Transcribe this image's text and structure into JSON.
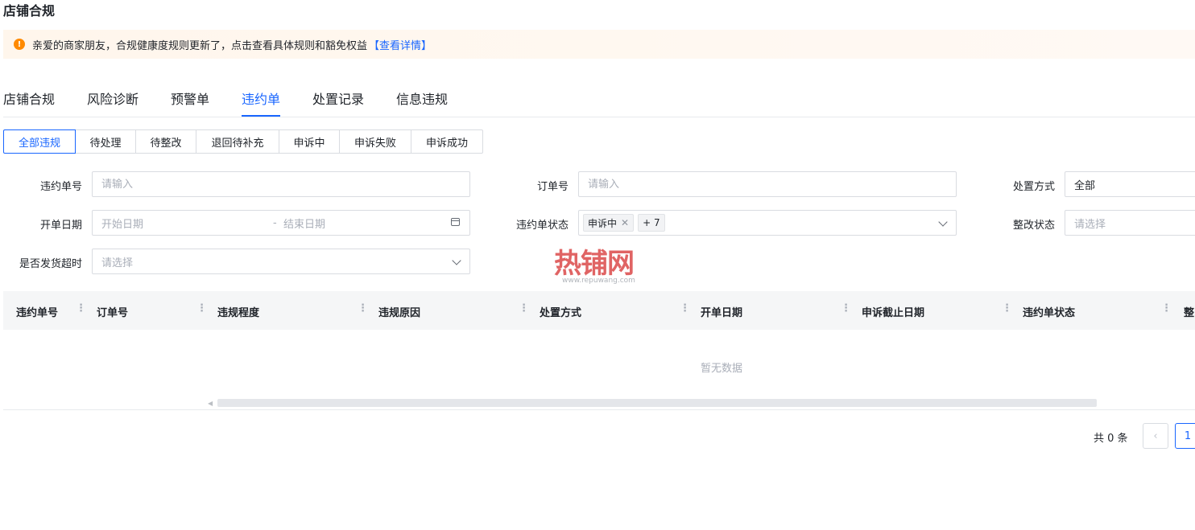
{
  "page": {
    "title": "店铺合规"
  },
  "notice": {
    "icon": "warning-icon",
    "text": "亲爱的商家朋友，合规健康度规则更新了，点击查看具体规则和豁免权益",
    "link": "【查看详情】"
  },
  "tabs": [
    {
      "label": "店铺合规",
      "active": false
    },
    {
      "label": "风险诊断",
      "active": false
    },
    {
      "label": "预警单",
      "active": false
    },
    {
      "label": "违约单",
      "active": true
    },
    {
      "label": "处置记录",
      "active": false
    },
    {
      "label": "信息违规",
      "active": false
    }
  ],
  "segments": [
    {
      "label": "全部违规",
      "active": true
    },
    {
      "label": "待处理",
      "active": false
    },
    {
      "label": "待整改",
      "active": false
    },
    {
      "label": "退回待补充",
      "active": false
    },
    {
      "label": "申诉中",
      "active": false
    },
    {
      "label": "申诉失败",
      "active": false
    },
    {
      "label": "申诉成功",
      "active": false
    }
  ],
  "filters": {
    "violation_no": {
      "label": "违约单号",
      "placeholder": "请输入"
    },
    "order_no": {
      "label": "订单号",
      "placeholder": "请输入"
    },
    "disposal_method": {
      "label": "处置方式",
      "value": "全部"
    },
    "open_date": {
      "label": "开单日期",
      "start_placeholder": "开始日期",
      "separator": "-",
      "end_placeholder": "结束日期"
    },
    "violation_status": {
      "label": "违约单状态",
      "tag": "申诉中",
      "more": "+ 7"
    },
    "rectify_status": {
      "label": "整改状态",
      "placeholder": "请选择"
    },
    "shipping_timeout": {
      "label": "是否发货超时",
      "placeholder": "请选择"
    }
  },
  "table": {
    "columns": [
      "违约单号",
      "订单号",
      "违规程度",
      "违规原因",
      "处置方式",
      "开单日期",
      "申诉截止日期",
      "违约单状态",
      "整"
    ],
    "empty_text": "暂无数据"
  },
  "pagination": {
    "total_text": "共 0 条",
    "prev": "‹",
    "current": "1"
  },
  "watermark": {
    "brand": "热铺网",
    "url": "www.repuwang.com"
  },
  "colors": {
    "primary": "#1966ff",
    "warning": "#ff8a00",
    "border": "#d9dce1",
    "placeholder": "#a9aeb8"
  }
}
